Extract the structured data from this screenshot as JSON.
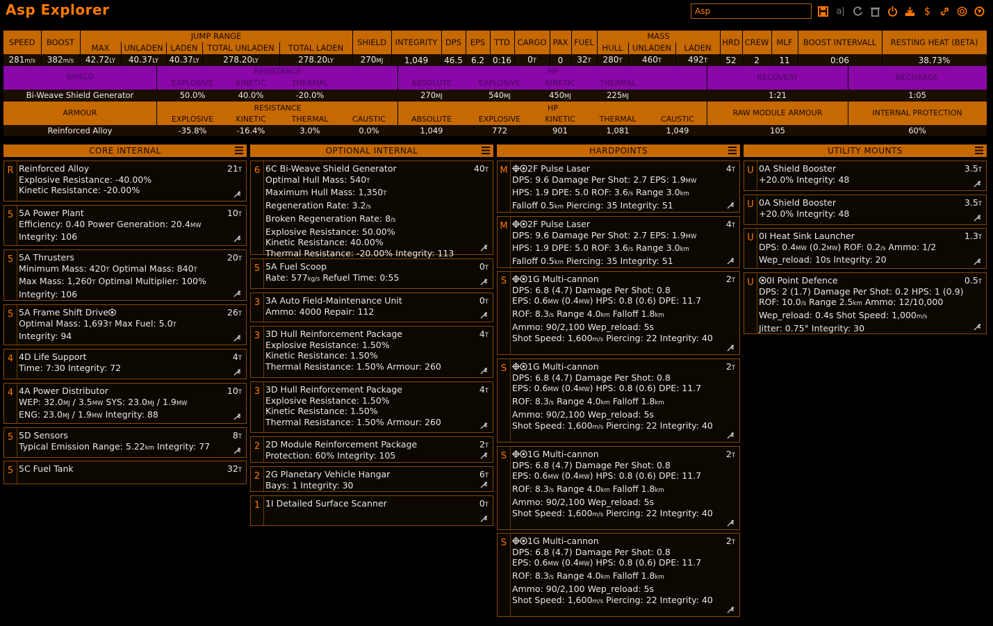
{
  "app": {
    "title": "Asp Explorer",
    "build_name": "Asp"
  },
  "stats": {
    "headers": {
      "speed": "SPEED",
      "boost": "BOOST",
      "jump_range": "JUMP RANGE",
      "jr_max": "MAX",
      "jr_unladen": "UNLADEN",
      "jr_laden": "LADEN",
      "jr_total_unladen": "TOTAL UNLADEN",
      "jr_total_laden": "TOTAL LADEN",
      "shield": "SHIELD",
      "integrity": "INTEGRITY",
      "dps": "DPS",
      "eps": "EPS",
      "ttd": "TTD",
      "cargo": "CARGO",
      "pax": "PAX",
      "fuel": "FUEL",
      "mass": "MASS",
      "m_hull": "HULL",
      "m_unladen": "UNLADEN",
      "m_laden": "LADEN",
      "hrd": "HRD",
      "crew": "CREW",
      "mlf": "MLF",
      "boost_interval": "BOOST INTERVALL",
      "resting_heat": "RESTING HEAT (BETA)"
    },
    "values": {
      "speed": "281",
      "speed_u": "m/s",
      "boost": "382",
      "boost_u": "m/s",
      "jr_max": "42.72",
      "jr_unladen": "40.37",
      "jr_laden": "40.37",
      "jr_total_unladen": "278.20",
      "jr_total_laden": "278.20",
      "ly": "LY",
      "shield": "270",
      "shield_u": "MJ",
      "integrity": "1,049",
      "dps": "46.5",
      "eps": "6.2",
      "ttd": "0:16",
      "cargo": "0",
      "t": "T",
      "pax": "0",
      "fuel": "32",
      "m_hull": "280",
      "m_unladen": "460",
      "m_laden": "492",
      "hrd": "52",
      "crew": "2",
      "mlf": "11",
      "boost_interval": "0:06",
      "resting_heat": "38.73%"
    }
  },
  "shield_block": {
    "label": "SHIELD",
    "resistance": "RESISTANCE",
    "explosive": "EXPLOSIVE",
    "kinetic": "KINETIC",
    "thermal": "THERMAL",
    "hp": "HP",
    "absolute": "ABSOLUTE",
    "recovery": "RECOVERY",
    "recharge": "RECHARGE",
    "name": "Bi-Weave Shield Generator",
    "res_explosive": "50.0%",
    "res_kinetic": "40.0%",
    "res_thermal": "-20.0%",
    "hp_absolute": "270",
    "hp_explosive": "540",
    "hp_kinetic": "450",
    "hp_thermal": "225",
    "mj": "MJ",
    "recovery_val": "1:21",
    "recharge_val": "1:05"
  },
  "armour_block": {
    "label": "ARMOUR",
    "resistance": "RESISTANCE",
    "explosive": "EXPLOSIVE",
    "kinetic": "KINETIC",
    "thermal": "THERMAL",
    "caustic": "CAUSTIC",
    "hp": "HP",
    "absolute": "ABSOLUTE",
    "raw": "RAW MODULE ARMOUR",
    "internal": "INTERNAL PROTECTION",
    "name": "Reinforced Alloy",
    "res_explosive": "-35.8%",
    "res_kinetic": "-16.4%",
    "res_thermal": "3.0%",
    "res_caustic": "0.0%",
    "hp_absolute": "1,049",
    "hp_explosive": "772",
    "hp_kinetic": "901",
    "hp_thermal": "1,081",
    "hp_caustic": "1,049",
    "raw_val": "105",
    "internal_val": "60%"
  },
  "panels": [
    {
      "title": "CORE INTERNAL",
      "slots": [
        {
          "cls": "R",
          "mass": "21T",
          "lines": [
            "Reinforced Alloy",
            "Explosive Resistance: -40.00%",
            "Kinetic Resistance: -20.00%"
          ]
        },
        {
          "cls": "5",
          "mass": "10T",
          "lines": [
            "5A Power Plant",
            "Efficiency: 0.40   Power Generation: 20.4MW",
            "Integrity: 106"
          ]
        },
        {
          "cls": "5",
          "mass": "20T",
          "lines": [
            "5A Thrusters",
            "Minimum Mass: 420T   Optimal Mass: 840T",
            "Max Mass: 1,260T   Optimal Multiplier: 100%",
            "Integrity: 106"
          ]
        },
        {
          "cls": "5",
          "mass": "26T",
          "lines": [
            "5A Frame Shift Drive",
            "Optimal Mass: 1,693T   Max Fuel: 5.0T",
            "Integrity: 94"
          ]
        },
        {
          "cls": "4",
          "mass": "4T",
          "lines": [
            "4D Life Support",
            "Time: 7:30   Integrity: 72"
          ]
        },
        {
          "cls": "4",
          "mass": "10T",
          "lines": [
            "4A Power Distributor",
            "WEP: 32.0MJ / 3.5MW   SYS: 23.0MJ / 1.9MW",
            "ENG: 23.0MJ / 1.9MW   Integrity: 88"
          ]
        },
        {
          "cls": "5",
          "mass": "8T",
          "lines": [
            "5D Sensors",
            "Typical Emission Range: 5.22km   Integrity: 77"
          ]
        },
        {
          "cls": "5",
          "mass": "32T",
          "lines": [
            "5C Fuel Tank"
          ]
        }
      ]
    },
    {
      "title": "OPTIONAL INTERNAL",
      "slots": [
        {
          "cls": "6",
          "mass": "40T",
          "lines": [
            "6C Bi-Weave Shield Generator",
            "Optimal Hull Mass: 540T",
            "Maximum Hull Mass: 1,350T",
            "Regeneration Rate: 3.2/s",
            "Broken Regeneration Rate: 8/s",
            "Explosive Resistance: 50.00%",
            "Kinetic Resistance: 40.00%",
            "Thermal Resistance: -20.00%   Integrity: 113"
          ]
        },
        {
          "cls": "5",
          "mass": "0T",
          "lines": [
            "5A Fuel Scoop",
            "Rate: 577kg/s   Refuel Time: 0:55"
          ]
        },
        {
          "cls": "3",
          "mass": "0T",
          "lines": [
            "3A Auto Field-Maintenance Unit",
            "Ammo: 4000   Repair: 112"
          ]
        },
        {
          "cls": "3",
          "mass": "4T",
          "lines": [
            "3D Hull Reinforcement Package",
            "Explosive Resistance: 1.50%",
            "Kinetic Resistance: 1.50%",
            "Thermal Resistance: 1.50%   Armour: 260"
          ]
        },
        {
          "cls": "3",
          "mass": "4T",
          "lines": [
            "3D Hull Reinforcement Package",
            "Explosive Resistance: 1.50%",
            "Kinetic Resistance: 1.50%",
            "Thermal Resistance: 1.50%   Armour: 260"
          ]
        },
        {
          "cls": "2",
          "mass": "2T",
          "lines": [
            "2D Module Reinforcement Package",
            "Protection: 60%   Integrity: 105"
          ]
        },
        {
          "cls": "2",
          "mass": "6T",
          "lines": [
            "2G Planetary Vehicle Hangar",
            "Bays: 1   Integrity: 30"
          ]
        },
        {
          "cls": "1",
          "mass": "0T",
          "lines": [
            "1I Detailed Surface Scanner"
          ]
        }
      ]
    },
    {
      "title": "HARDPOINTS",
      "slots": [
        {
          "cls": "M",
          "mass": "4T",
          "lines": [
            "2F Pulse Laser",
            "DPS: 9.6   Damage Per Shot: 2.7   EPS: 1.9MW",
            "HPS: 1.9   DPE: 5.0   ROF: 3.6/s   Range 3.0km",
            "Falloff 0.5km   Piercing: 35   Integrity: 51"
          ]
        },
        {
          "cls": "M",
          "mass": "4T",
          "lines": [
            "2F Pulse Laser",
            "DPS: 9.6   Damage Per Shot: 2.7   EPS: 1.9MW",
            "HPS: 1.9   DPE: 5.0   ROF: 3.6/s   Range 3.0km",
            "Falloff 0.5km   Piercing: 35   Integrity: 51"
          ]
        },
        {
          "cls": "S",
          "mass": "2T",
          "lines": [
            "1G Multi-cannon",
            "DPS: 6.8 (4.7)   Damage Per Shot: 0.8",
            "EPS: 0.6MW (0.4MW)   HPS: 0.8 (0.6)   DPE: 11.7",
            "ROF: 8.3/s   Range 4.0km   Falloff 1.8km",
            "Ammo: 90/2,100   Wep_reload: 5s",
            "Shot Speed: 1,600m/s   Piercing: 22   Integrity: 40"
          ]
        },
        {
          "cls": "S",
          "mass": "2T",
          "lines": [
            "1G Multi-cannon",
            "DPS: 6.8 (4.7)   Damage Per Shot: 0.8",
            "EPS: 0.6MW (0.4MW)   HPS: 0.8 (0.6)   DPE: 11.7",
            "ROF: 8.3/s   Range 4.0km   Falloff 1.8km",
            "Ammo: 90/2,100   Wep_reload: 5s",
            "Shot Speed: 1,600m/s   Piercing: 22   Integrity: 40"
          ]
        },
        {
          "cls": "S",
          "mass": "2T",
          "lines": [
            "1G Multi-cannon",
            "DPS: 6.8 (4.7)   Damage Per Shot: 0.8",
            "EPS: 0.6MW (0.4MW)   HPS: 0.8 (0.6)   DPE: 11.7",
            "ROF: 8.3/s   Range 4.0km   Falloff 1.8km",
            "Ammo: 90/2,100   Wep_reload: 5s",
            "Shot Speed: 1,600m/s   Piercing: 22   Integrity: 40"
          ]
        },
        {
          "cls": "S",
          "mass": "2T",
          "lines": [
            "1G Multi-cannon",
            "DPS: 6.8 (4.7)   Damage Per Shot: 0.8",
            "EPS: 0.6MW (0.4MW)   HPS: 0.8 (0.6)   DPE: 11.7",
            "ROF: 8.3/s   Range 4.0km   Falloff 1.8km",
            "Ammo: 90/2,100   Wep_reload: 5s",
            "Shot Speed: 1,600m/s   Piercing: 22   Integrity: 40"
          ]
        }
      ]
    },
    {
      "title": "UTILITY MOUNTS",
      "slots": [
        {
          "cls": "U",
          "mass": "3.5T",
          "lines": [
            "0A Shield Booster",
            "+20.0%   Integrity: 48"
          ]
        },
        {
          "cls": "U",
          "mass": "3.5T",
          "lines": [
            "0A Shield Booster",
            "+20.0%   Integrity: 48"
          ]
        },
        {
          "cls": "U",
          "mass": "1.3T",
          "lines": [
            "0I Heat Sink Launcher",
            "DPS: 0.4MW (0.2MW)   ROF: 0.2/s   Ammo: 1/2",
            "Wep_reload: 10s   Integrity: 20"
          ]
        },
        {
          "cls": "U",
          "mass": "0.5T",
          "lines": [
            "0I Point Defence",
            "DPS: 2 (1.7)   Damage Per Shot: 0.2   HPS: 1 (0.9)",
            "ROF: 10.0/s   Range 2.5km   Ammo: 12/10,000",
            "Wep_reload: 0.4s   Shot Speed: 1,000m/s",
            "Jitter: 0.75°   Integrity: 30"
          ]
        }
      ]
    }
  ]
}
